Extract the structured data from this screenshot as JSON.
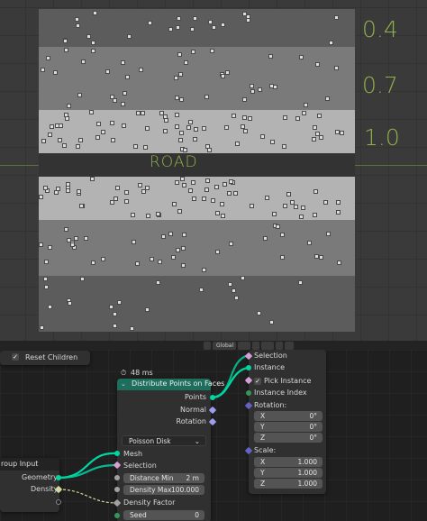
{
  "viewport": {
    "band_labels": [
      "0.4",
      "0.7",
      "1.0"
    ],
    "road_label": "ROAD"
  },
  "header": {
    "orientation": "Global"
  },
  "reset_node": {
    "label": "Reset Children",
    "checked": true
  },
  "group_input": {
    "title": "roup Input",
    "outputs": [
      "Geometry",
      "Density"
    ]
  },
  "timing_badge": "48 ms",
  "distribute_node": {
    "title": "Distribute Points on Faces",
    "outputs": [
      "Points",
      "Normal",
      "Rotation"
    ],
    "mode": "Poisson Disk",
    "inputs": [
      "Mesh",
      "Selection"
    ],
    "distance_min_label": "Distance Min",
    "distance_min_value": "2 m",
    "density_max_label": "Density Max",
    "density_max_value": "100.000",
    "density_factor_label": "Density Factor",
    "seed_label": "Seed",
    "seed_value": "0"
  },
  "instance_node": {
    "inputs": [
      "Selection",
      "Instance"
    ],
    "pick_instance": "Pick Instance",
    "instance_index": "Instance Index",
    "rotation_label": "Rotation:",
    "rotation": [
      {
        "axis": "X",
        "value": "0°"
      },
      {
        "axis": "Y",
        "value": "0°"
      },
      {
        "axis": "Z",
        "value": "0°"
      }
    ],
    "scale_label": "Scale:",
    "scale": [
      {
        "axis": "X",
        "value": "1.000"
      },
      {
        "axis": "Y",
        "value": "1.000"
      },
      {
        "axis": "Z",
        "value": "1.000"
      }
    ]
  },
  "colors": {
    "geometry_socket": "#00d6a3",
    "field_socket": "#9d9df0",
    "float_socket": "#a1a1a1",
    "vector_socket": "#6363c7",
    "int_socket": "#35965a",
    "node_header_green": "#1e6e5e",
    "annotation": "#8fb14a"
  }
}
